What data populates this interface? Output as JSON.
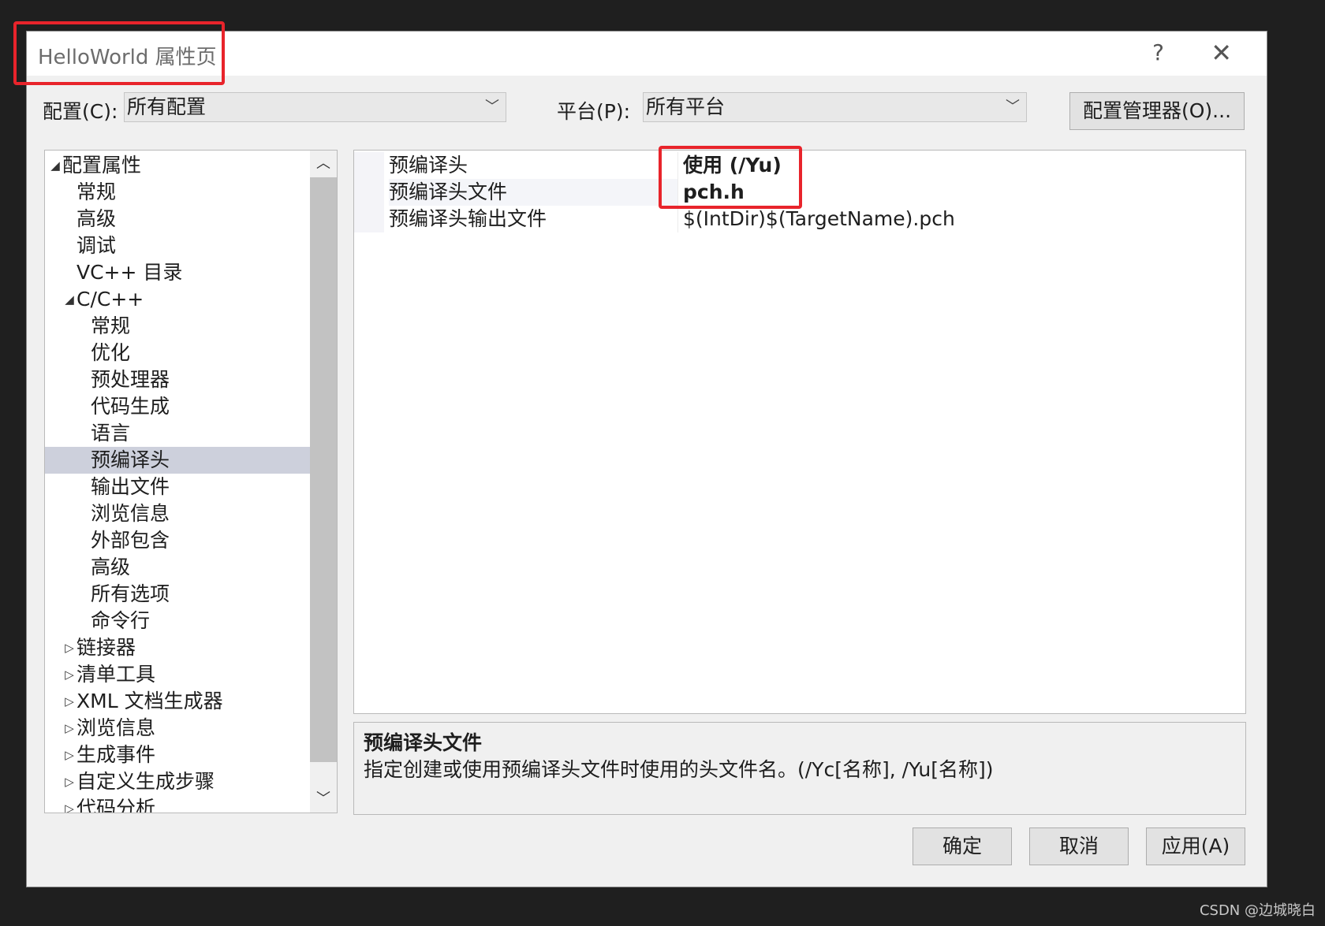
{
  "window": {
    "title": "HelloWorld 属性页",
    "help": "?",
    "close": "✕"
  },
  "config": {
    "label": "配置(C):",
    "value": "所有配置"
  },
  "platform": {
    "label": "平台(P):",
    "value": "所有平台"
  },
  "config_manager_button": "配置管理器(O)...",
  "tree": [
    {
      "label": "配置属性",
      "level": 0,
      "arrow": "◢",
      "selected": false
    },
    {
      "label": "常规",
      "level": 1,
      "arrow": "",
      "selected": false
    },
    {
      "label": "高级",
      "level": 1,
      "arrow": "",
      "selected": false
    },
    {
      "label": "调试",
      "level": 1,
      "arrow": "",
      "selected": false
    },
    {
      "label": "VC++ 目录",
      "level": 1,
      "arrow": "",
      "selected": false
    },
    {
      "label": "C/C++",
      "level": 1,
      "arrow": "◢",
      "selected": false
    },
    {
      "label": "常规",
      "level": 2,
      "arrow": "",
      "selected": false
    },
    {
      "label": "优化",
      "level": 2,
      "arrow": "",
      "selected": false
    },
    {
      "label": "预处理器",
      "level": 2,
      "arrow": "",
      "selected": false
    },
    {
      "label": "代码生成",
      "level": 2,
      "arrow": "",
      "selected": false
    },
    {
      "label": "语言",
      "level": 2,
      "arrow": "",
      "selected": false
    },
    {
      "label": "预编译头",
      "level": 2,
      "arrow": "",
      "selected": true
    },
    {
      "label": "输出文件",
      "level": 2,
      "arrow": "",
      "selected": false
    },
    {
      "label": "浏览信息",
      "level": 2,
      "arrow": "",
      "selected": false
    },
    {
      "label": "外部包含",
      "level": 2,
      "arrow": "",
      "selected": false
    },
    {
      "label": "高级",
      "level": 2,
      "arrow": "",
      "selected": false
    },
    {
      "label": "所有选项",
      "level": 2,
      "arrow": "",
      "selected": false
    },
    {
      "label": "命令行",
      "level": 2,
      "arrow": "",
      "selected": false
    },
    {
      "label": "链接器",
      "level": 1,
      "arrow": "▷",
      "selected": false
    },
    {
      "label": "清单工具",
      "level": 1,
      "arrow": "▷",
      "selected": false
    },
    {
      "label": "XML 文档生成器",
      "level": 1,
      "arrow": "▷",
      "selected": false
    },
    {
      "label": "浏览信息",
      "level": 1,
      "arrow": "▷",
      "selected": false
    },
    {
      "label": "生成事件",
      "level": 1,
      "arrow": "▷",
      "selected": false
    },
    {
      "label": "自定义生成步骤",
      "level": 1,
      "arrow": "▷",
      "selected": false
    },
    {
      "label": "代码分析",
      "level": 1,
      "arrow": "▷",
      "selected": false
    }
  ],
  "properties": [
    {
      "name": "预编译头",
      "value": "使用 (/Yu)",
      "bold": true
    },
    {
      "name": "预编译头文件",
      "value": "pch.h",
      "bold": true
    },
    {
      "name": "预编译头输出文件",
      "value": "$(IntDir)$(TargetName).pch",
      "bold": false
    }
  ],
  "description": {
    "title": "预编译头文件",
    "text": "指定创建或使用预编译头文件时使用的头文件名。(/Yc[名称], /Yu[名称])"
  },
  "buttons": {
    "ok": "确定",
    "cancel": "取消",
    "apply": "应用(A)"
  },
  "watermark": "CSDN @边城晓白",
  "colors": {
    "highlight_box": "#e8242b",
    "selected_row": "#cdd0dc"
  }
}
